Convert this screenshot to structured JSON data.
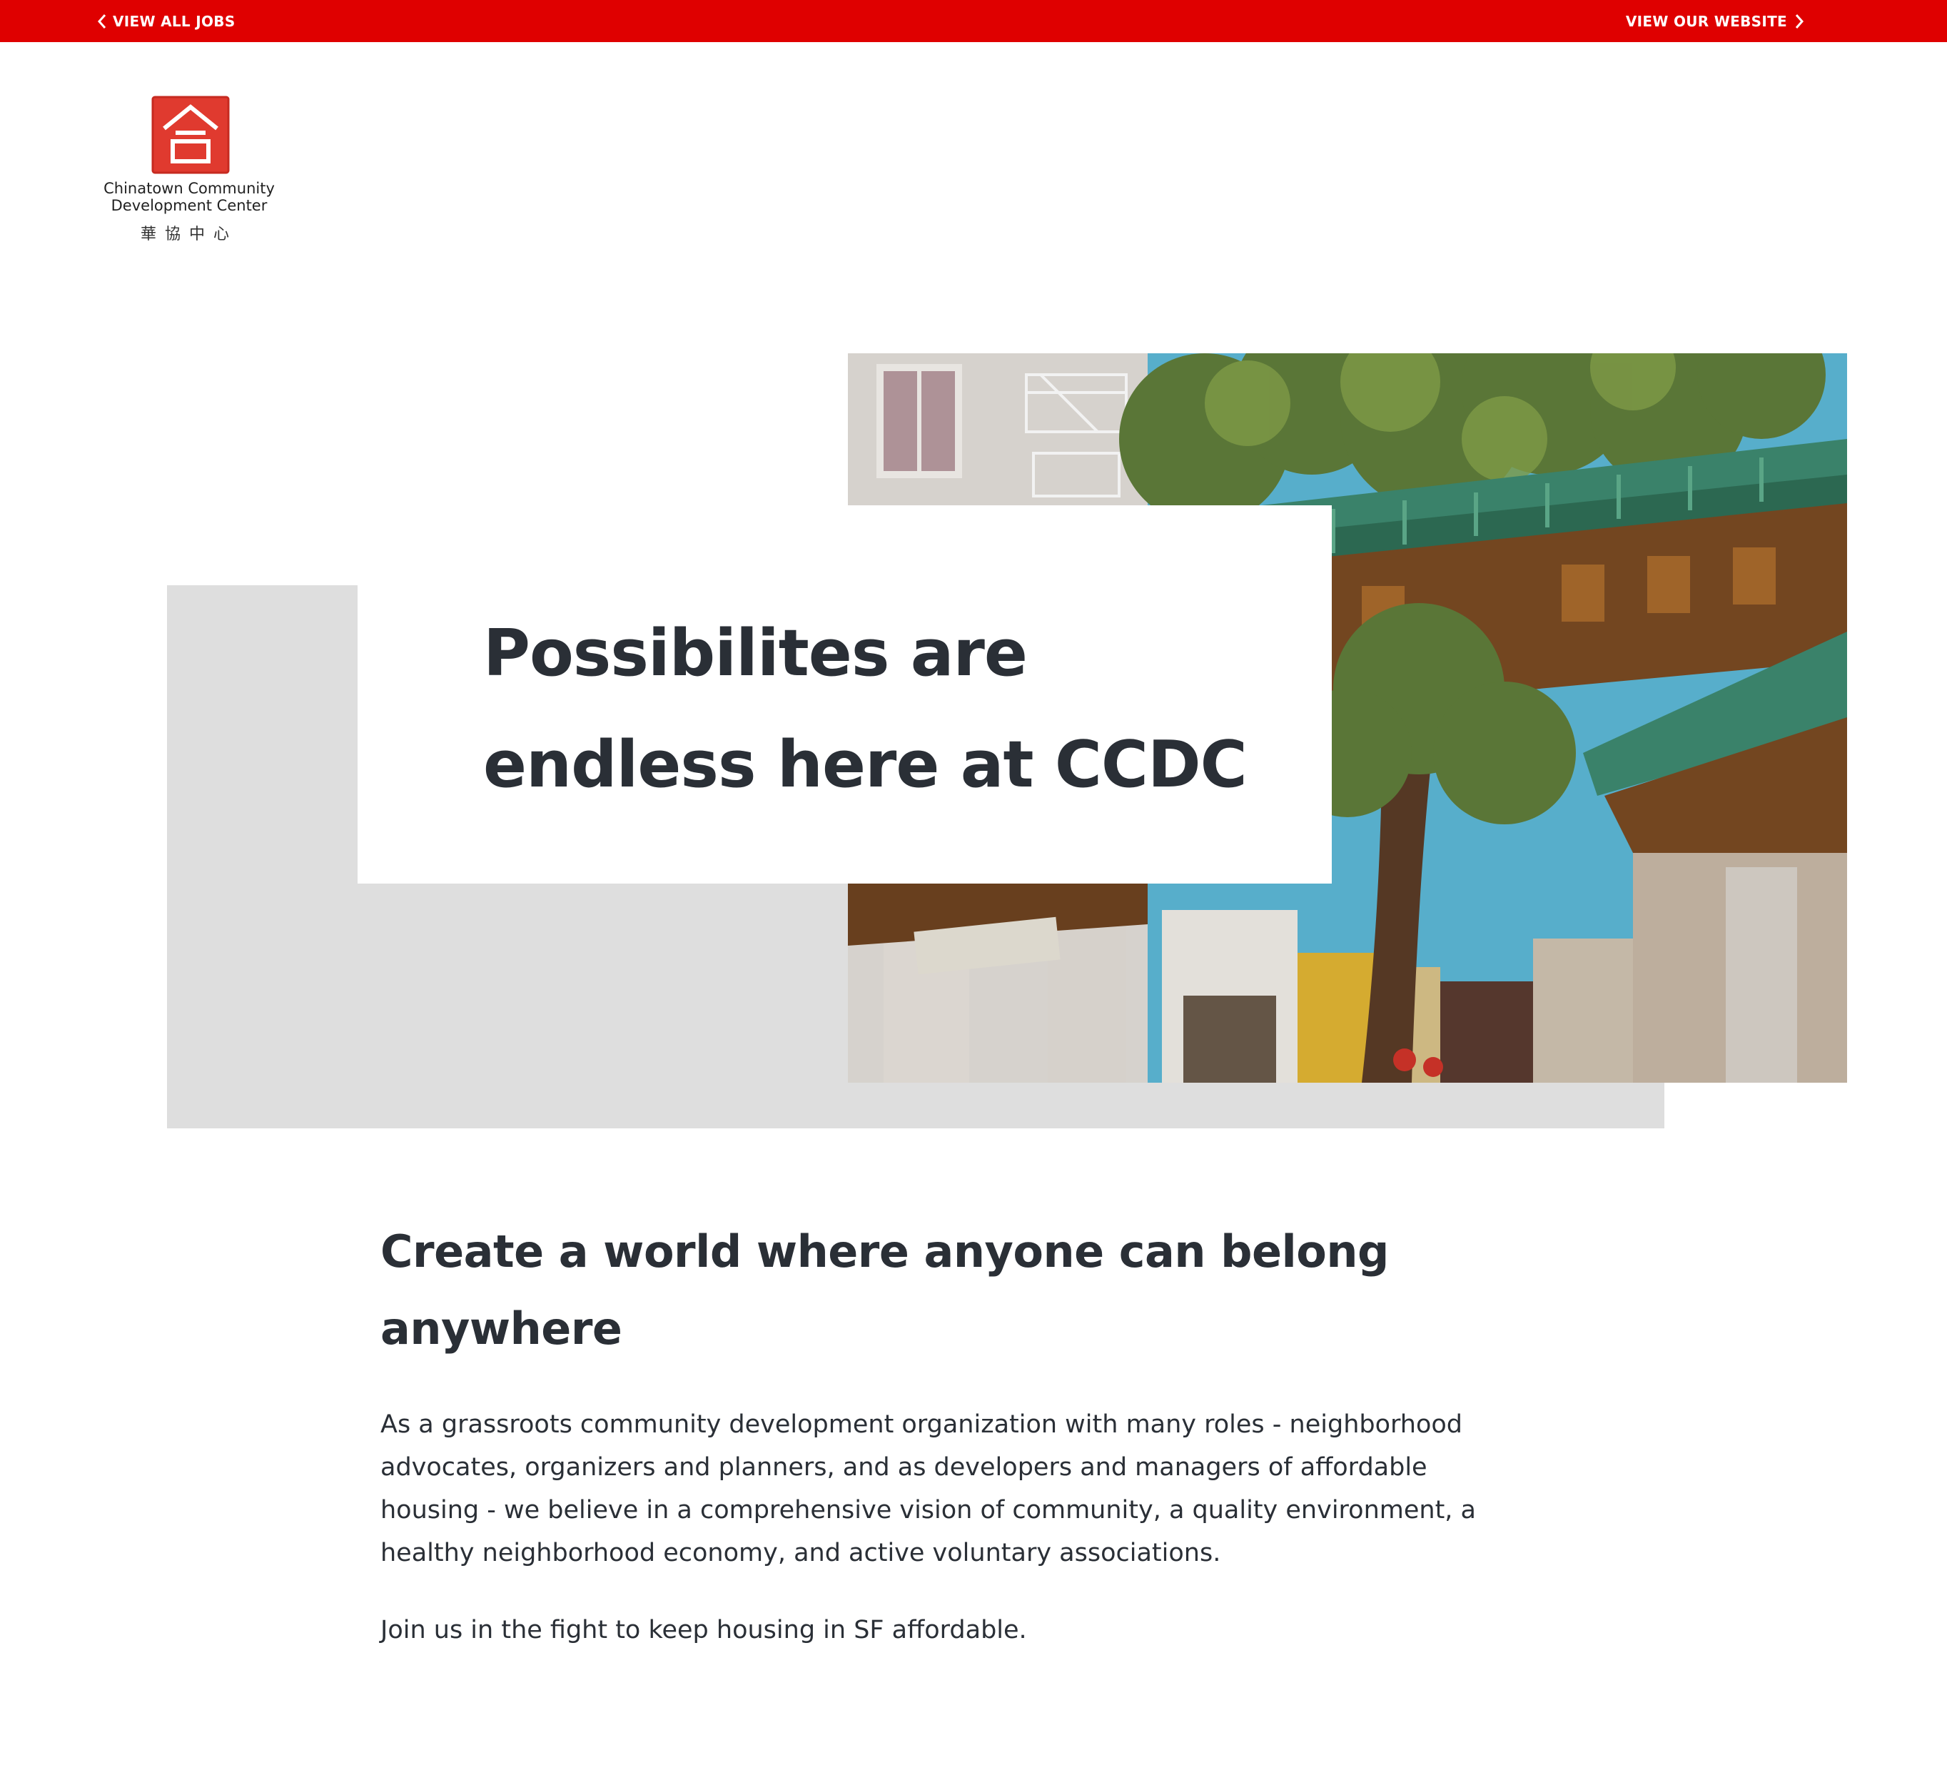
{
  "topbar": {
    "view_all_jobs": "VIEW ALL JOBS",
    "view_website": "VIEW OUR WEBSITE",
    "color": "#df0000"
  },
  "logo": {
    "name_line1": "Chinatown Community",
    "name_line2": "Development Center",
    "chinese": "華協中心",
    "color": "#e03a2f"
  },
  "hero": {
    "title_line1": "Possibilites are",
    "title_line2": "endless here at CCDC",
    "photo": "chinatown-gate-photo"
  },
  "content": {
    "heading": "Create a world where anyone can belong anywhere",
    "paragraph1": "As a grassroots community development organization with many roles - neighborhood advocates, organizers and planners, and as developers and managers of affordable housing - we believe in a comprehensive vision of community, a quality environment, a healthy neighborhood economy, and active voluntary associations.",
    "paragraph2": "Join us in the fight to keep housing in SF affordable."
  }
}
